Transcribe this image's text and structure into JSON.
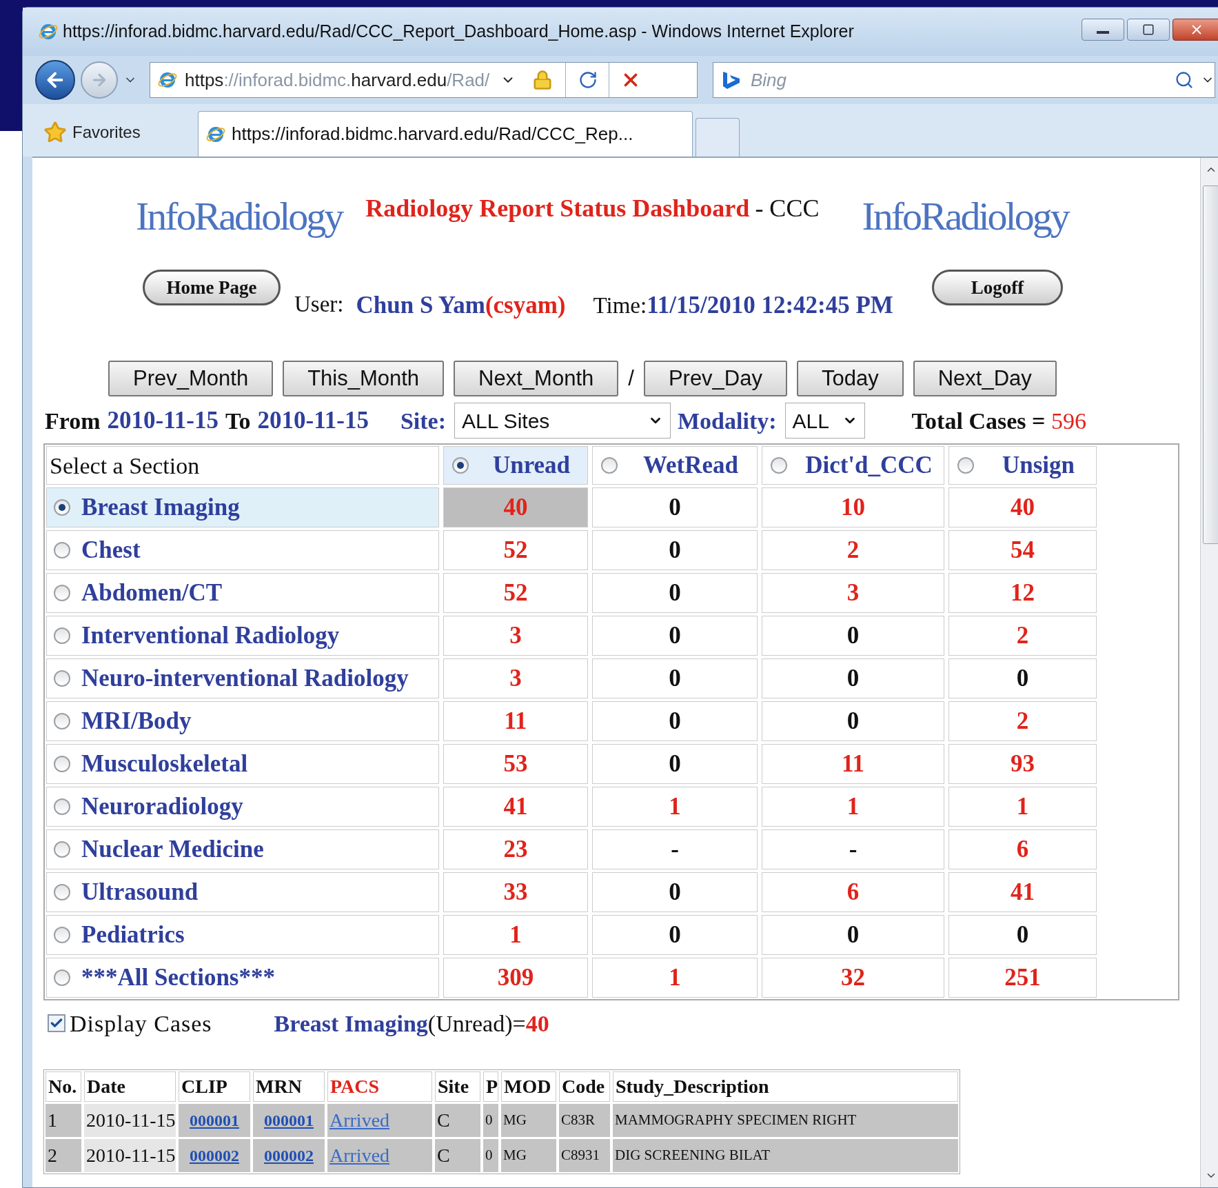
{
  "window": {
    "title": "https://inforad.bidmc.harvard.edu/Rad/CCC_Report_Dashboard_Home.asp - Windows Internet Explorer"
  },
  "address_bar": {
    "scheme": "https",
    "rest_dim": "://inforad.bidmc.",
    "domain": "harvard.edu",
    "path": "/Rad/"
  },
  "search": {
    "placeholder": "Bing"
  },
  "favorites": {
    "label": "Favorites"
  },
  "tabs": [
    {
      "label": "https://inforad.bidmc.harvard.edu/Rad/CCC_Rep...",
      "selected": true
    }
  ],
  "header": {
    "logo_left": "InfoRadiology",
    "title": "Radiology Report Status Dashboard",
    "suffix": "- CCC",
    "logo_right": "InfoRadiology"
  },
  "user_bar": {
    "home_button": "Home Page",
    "user_label": "User:",
    "user_name": "Chun S Yam",
    "user_id": "(csyam)",
    "time_label": "Time:",
    "time": "11/15/2010 12:42:45 PM",
    "logoff_button": "Logoff"
  },
  "nav_buttons": [
    {
      "label": "Prev_Month"
    },
    {
      "label": "This_Month"
    },
    {
      "label": "Next_Month"
    },
    {
      "label": "Prev_Day"
    },
    {
      "label": "Today"
    },
    {
      "label": "Next_Day"
    }
  ],
  "nav_separator": "/",
  "filter": {
    "from_label": "From",
    "from": "2010-11-15",
    "to_label": "To",
    "to": "2010-11-15",
    "site_label": "Site:",
    "site": "ALL Sites",
    "modality_label": "Modality:",
    "modality": "ALL",
    "total_label": "Total Cases =",
    "total": "596"
  },
  "section_table": {
    "corner": "Select a Section",
    "columns": [
      {
        "label": "Unread",
        "selected": true
      },
      {
        "label": "WetRead",
        "selected": false
      },
      {
        "label": "Dict'd_CCC",
        "selected": false
      },
      {
        "label": "Unsign",
        "selected": false
      }
    ],
    "rows": [
      {
        "name": "Breast Imaging",
        "selected": true,
        "cells": [
          {
            "text": "40",
            "flagged": true
          },
          {
            "text": "0",
            "flagged": false
          },
          {
            "text": "10",
            "flagged": true
          },
          {
            "text": "40",
            "flagged": true
          }
        ]
      },
      {
        "name": "Chest",
        "selected": false,
        "cells": [
          {
            "text": "52",
            "flagged": true
          },
          {
            "text": "0",
            "flagged": false
          },
          {
            "text": "2",
            "flagged": true
          },
          {
            "text": "54",
            "flagged": true
          }
        ]
      },
      {
        "name": "Abdomen/CT",
        "selected": false,
        "cells": [
          {
            "text": "52",
            "flagged": true
          },
          {
            "text": "0",
            "flagged": false
          },
          {
            "text": "3",
            "flagged": true
          },
          {
            "text": "12",
            "flagged": true
          }
        ]
      },
      {
        "name": "Interventional Radiology",
        "selected": false,
        "cells": [
          {
            "text": "3",
            "flagged": true
          },
          {
            "text": "0",
            "flagged": false
          },
          {
            "text": "0",
            "flagged": false
          },
          {
            "text": "2",
            "flagged": true
          }
        ]
      },
      {
        "name": "Neuro-interventional Radiology",
        "selected": false,
        "cells": [
          {
            "text": "3",
            "flagged": true
          },
          {
            "text": "0",
            "flagged": false
          },
          {
            "text": "0",
            "flagged": false
          },
          {
            "text": "0",
            "flagged": false
          }
        ]
      },
      {
        "name": "MRI/Body",
        "selected": false,
        "cells": [
          {
            "text": "11",
            "flagged": true
          },
          {
            "text": "0",
            "flagged": false
          },
          {
            "text": "0",
            "flagged": false
          },
          {
            "text": "2",
            "flagged": true
          }
        ]
      },
      {
        "name": "Musculoskeletal",
        "selected": false,
        "cells": [
          {
            "text": "53",
            "flagged": true
          },
          {
            "text": "0",
            "flagged": false
          },
          {
            "text": "11",
            "flagged": true
          },
          {
            "text": "93",
            "flagged": true
          }
        ]
      },
      {
        "name": "Neuroradiology",
        "selected": false,
        "cells": [
          {
            "text": "41",
            "flagged": true
          },
          {
            "text": "1",
            "flagged": true
          },
          {
            "text": "1",
            "flagged": true
          },
          {
            "text": "1",
            "flagged": true
          }
        ]
      },
      {
        "name": "Nuclear Medicine",
        "selected": false,
        "cells": [
          {
            "text": "23",
            "flagged": true
          },
          {
            "text": "-",
            "flagged": false
          },
          {
            "text": "-",
            "flagged": false
          },
          {
            "text": "6",
            "flagged": true
          }
        ]
      },
      {
        "name": "Ultrasound",
        "selected": false,
        "cells": [
          {
            "text": "33",
            "flagged": true
          },
          {
            "text": "0",
            "flagged": false
          },
          {
            "text": "6",
            "flagged": true
          },
          {
            "text": "41",
            "flagged": true
          }
        ]
      },
      {
        "name": "Pediatrics",
        "selected": false,
        "cells": [
          {
            "text": "1",
            "flagged": true
          },
          {
            "text": "0",
            "flagged": false
          },
          {
            "text": "0",
            "flagged": false
          },
          {
            "text": "0",
            "flagged": false
          }
        ]
      },
      {
        "name": "***All Sections***",
        "selected": false,
        "cells": [
          {
            "text": "309",
            "flagged": true
          },
          {
            "text": "1",
            "flagged": true
          },
          {
            "text": "32",
            "flagged": true
          },
          {
            "text": "251",
            "flagged": true
          }
        ]
      }
    ]
  },
  "display_cases": {
    "checked": true,
    "label": "Display Cases",
    "section": "Breast Imaging",
    "status": "(Unread)=",
    "count": "40"
  },
  "cases_table": {
    "columns": [
      {
        "label": "No.",
        "highlighted": false
      },
      {
        "label": "Date",
        "highlighted": false
      },
      {
        "label": "CLIP",
        "highlighted": false
      },
      {
        "label": "MRN",
        "highlighted": false
      },
      {
        "label": "PACS",
        "highlighted": true
      },
      {
        "label": "Site",
        "highlighted": false
      },
      {
        "label": "P",
        "highlighted": false
      },
      {
        "label": "MOD",
        "highlighted": false
      },
      {
        "label": "Code",
        "highlighted": false
      },
      {
        "label": "Study_Description",
        "highlighted": false
      }
    ],
    "rows": [
      {
        "no": "1",
        "date": "2010-11-15",
        "clip": "000001",
        "mrn": "000001",
        "pacs": "Arrived",
        "site": "C",
        "p": "0",
        "mod": "MG",
        "code": "C83R",
        "description": "MAMMOGRAPHY SPECIMEN RIGHT"
      },
      {
        "no": "2",
        "date": "2010-11-15",
        "clip": "000002",
        "mrn": "000002",
        "pacs": "Arrived",
        "site": "C",
        "p": "0",
        "mod": "MG",
        "code": "C8931",
        "description": "DIG SCREENING BILAT"
      }
    ]
  }
}
